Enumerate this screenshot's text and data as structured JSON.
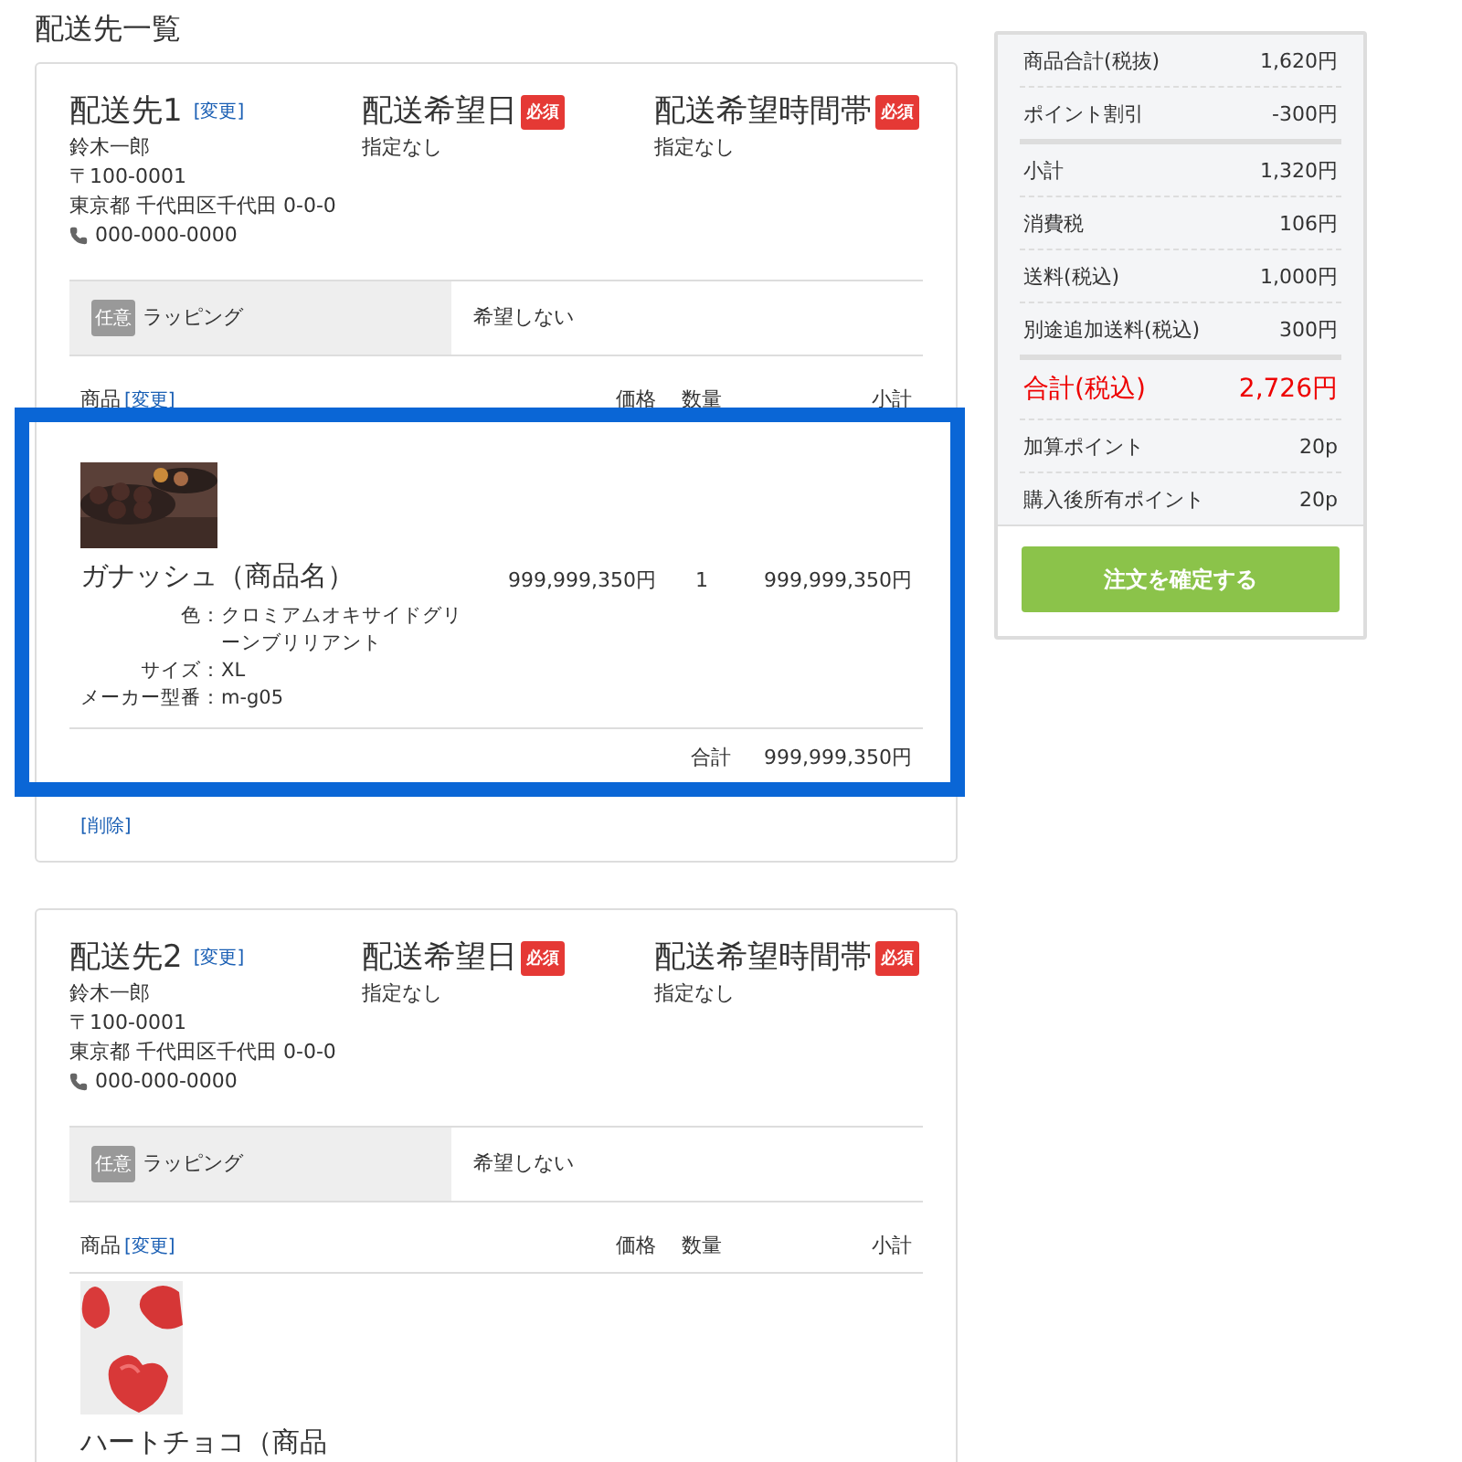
{
  "page_title": "配送先一覧",
  "shipments": [
    {
      "title": "配送先1",
      "change_link": "[変更]",
      "name": "鈴木一郎",
      "postal": "〒100-0001",
      "address": "東京都 千代田区千代田 0-0-0",
      "phone": "000-000-0000",
      "date_label": "配送希望日",
      "date_badge": "必須",
      "date_value": "指定なし",
      "time_label": "配送希望時間帯",
      "time_badge": "必須",
      "time_value": "指定なし",
      "wrapping": {
        "badge": "任意",
        "label": "ラッピング",
        "value": "希望しない"
      },
      "items_header": {
        "product": "商品",
        "change_link": "[変更]",
        "price": "価格",
        "quantity": "数量",
        "subtotal": "小計"
      },
      "items": [
        {
          "name": "ガナッシュ（商品名）",
          "options": [
            {
              "label": "色：",
              "value": "クロミアムオキサイドグリーンブリリアント"
            },
            {
              "label": "サイズ：",
              "value": "XL"
            },
            {
              "label": "メーカー型番：",
              "value": "m-g05"
            }
          ],
          "price": "999,999,350円",
          "quantity": "1",
          "subtotal": "999,999,350円",
          "highlighted": true
        }
      ],
      "total_label": "合計",
      "total": "999,999,350円",
      "delete_link": "[削除]"
    },
    {
      "title": "配送先2",
      "change_link": "[変更]",
      "name": "鈴木一郎",
      "postal": "〒100-0001",
      "address": "東京都 千代田区千代田 0-0-0",
      "phone": "000-000-0000",
      "date_label": "配送希望日",
      "date_badge": "必須",
      "date_value": "指定なし",
      "time_label": "配送希望時間帯",
      "time_badge": "必須",
      "time_value": "指定なし",
      "wrapping": {
        "badge": "任意",
        "label": "ラッピング",
        "value": "希望しない"
      },
      "items_header": {
        "product": "商品",
        "change_link": "[変更]",
        "price": "価格",
        "quantity": "数量",
        "subtotal": "小計"
      },
      "items": [
        {
          "name": "ハートチョコ（商品",
          "highlighted": false
        }
      ]
    }
  ],
  "summary": {
    "groups": [
      [
        {
          "label": "商品合計(税抜)",
          "value": "1,620円",
          "kind": "normal"
        },
        {
          "label": "ポイント割引",
          "value": "-300円",
          "kind": "normal"
        }
      ],
      [
        {
          "label": "小計",
          "value": "1,320円",
          "kind": "normal"
        },
        {
          "label": "消費税",
          "value": "106円",
          "kind": "normal"
        },
        {
          "label": "送料(税込)",
          "value": "1,000円",
          "kind": "normal"
        },
        {
          "label": "別途追加送料(税込)",
          "value": "300円",
          "kind": "normal"
        }
      ],
      [
        {
          "label": "合計(税込)",
          "value": "2,726円",
          "kind": "total"
        },
        {
          "label": "加算ポイント",
          "value": "20p",
          "kind": "normal"
        },
        {
          "label": "購入後所有ポイント",
          "value": "20p",
          "kind": "normal"
        }
      ]
    ],
    "button": "注文を確定する"
  }
}
